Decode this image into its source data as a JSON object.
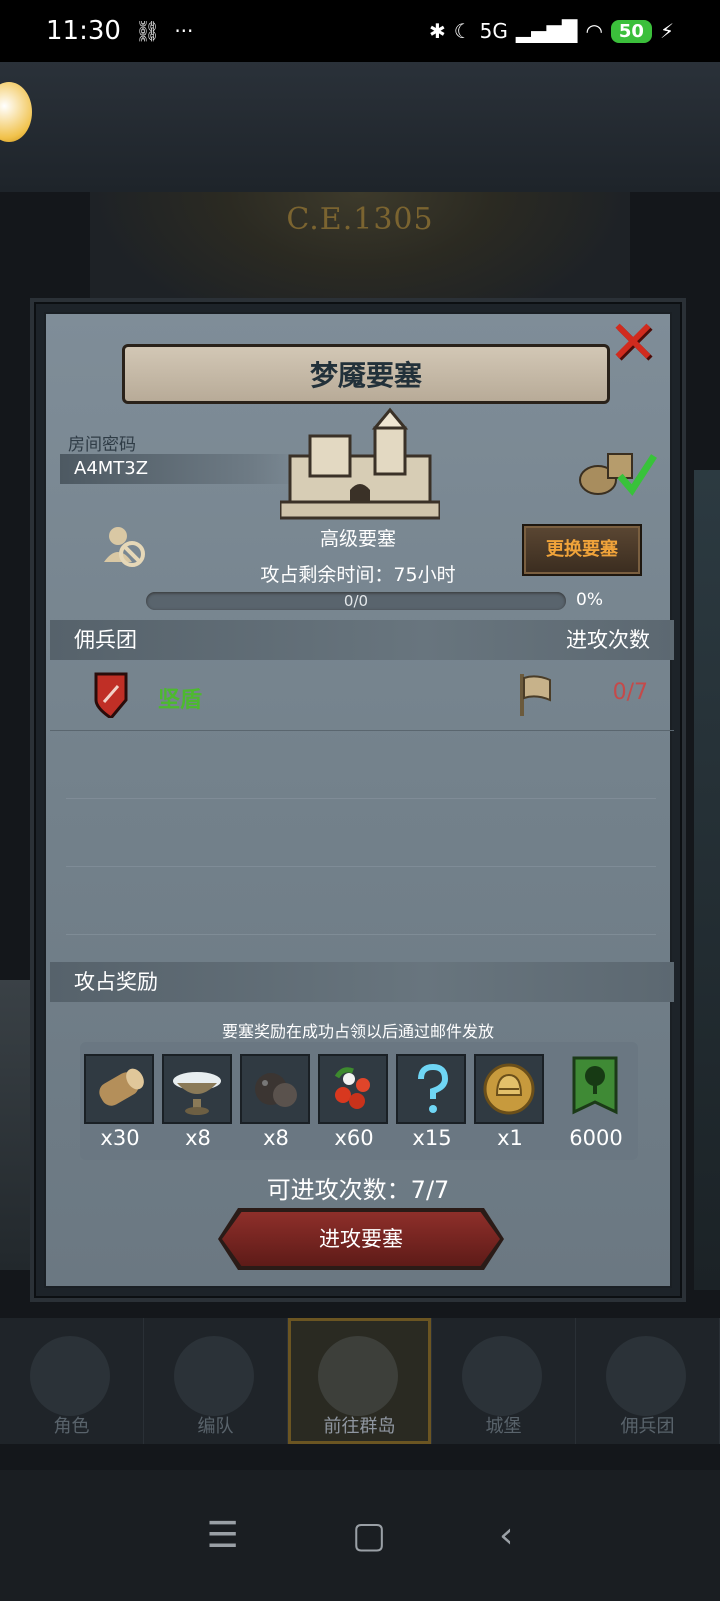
{
  "status_bar": {
    "time": "11:30",
    "battery": "50",
    "network": "5G"
  },
  "background": {
    "clock_label": "C.E.1305"
  },
  "modal": {
    "title": "梦魇要塞",
    "room_code_label": "房间密码",
    "room_code": "A4MT3Z",
    "fortress_level": "高级要塞",
    "change_button": "更换要塞",
    "time_left": "攻占剩余时间：75小时",
    "progress_text": "0/0",
    "progress_value": 0,
    "progress_pct": "0%",
    "merc_header": "佣兵团",
    "attack_count_header": "进攻次数",
    "merc_rows": [
      {
        "name": "坚盾",
        "attacks": "0/7"
      }
    ],
    "rewards_header": "攻占奖励",
    "reward_note": "要塞奖励在成功占领以后通过邮件发放",
    "rewards": [
      {
        "icon": "wood-log-icon",
        "qty": "x30"
      },
      {
        "icon": "silver-bowl-icon",
        "qty": "x8"
      },
      {
        "icon": "truffle-icon",
        "qty": "x8"
      },
      {
        "icon": "berries-icon",
        "qty": "x60"
      },
      {
        "icon": "mystery-question-icon",
        "qty": "x15"
      },
      {
        "icon": "gold-helmet-medal-icon",
        "qty": "x1"
      },
      {
        "icon": "tree-banner-icon",
        "qty": "6000"
      }
    ],
    "attacks_available": "可进攻次数：7/7",
    "attack_button": "进攻要塞",
    "colors": {
      "accent_red": "#8e2f2a",
      "merc_green": "#4dba2e",
      "attack_red": "#c44a4a"
    }
  },
  "bottom_nav": [
    {
      "label": "角色",
      "active": false
    },
    {
      "label": "编队",
      "active": false
    },
    {
      "label": "前往群岛",
      "active": true
    },
    {
      "label": "城堡",
      "active": false
    },
    {
      "label": "佣兵团",
      "active": false
    }
  ]
}
